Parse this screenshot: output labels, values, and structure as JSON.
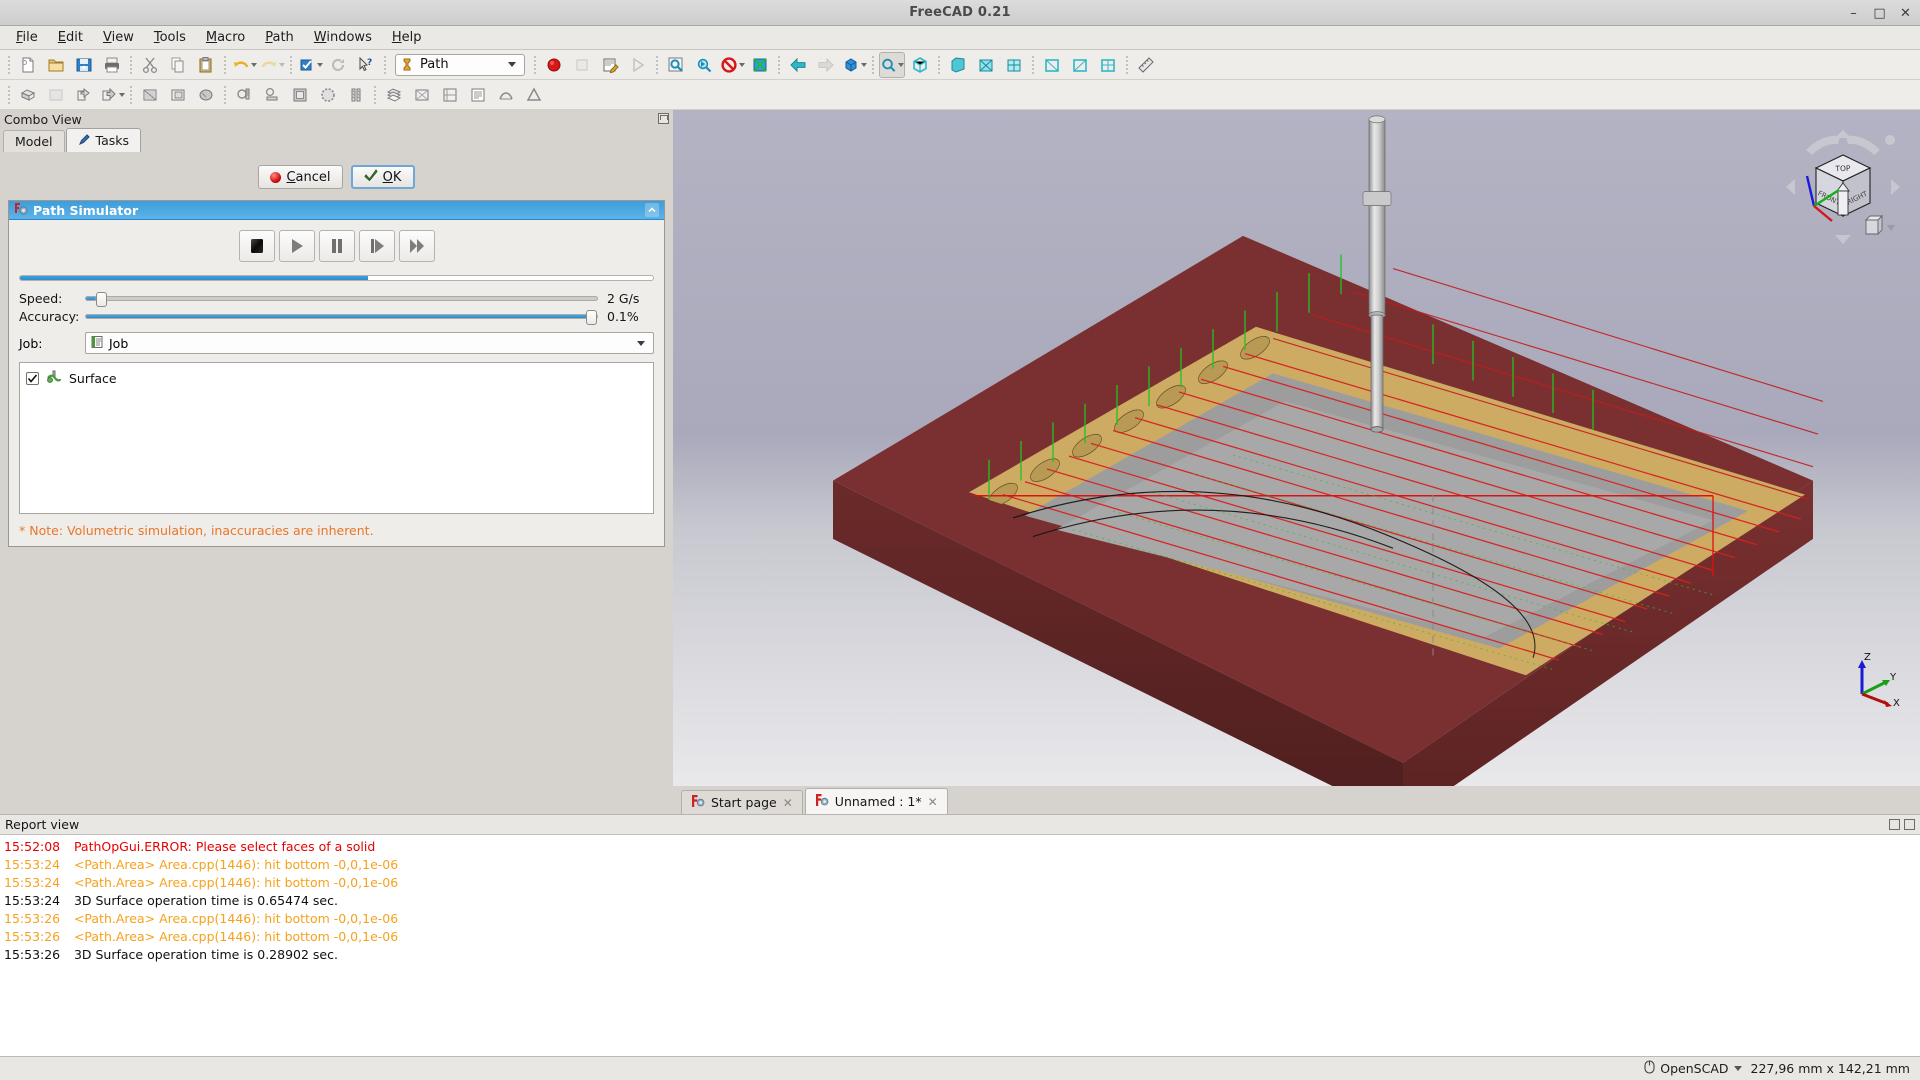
{
  "window": {
    "title": "FreeCAD 0.21",
    "controls": {
      "minimize": "–",
      "maximize": "□",
      "close": "✕"
    }
  },
  "menubar": {
    "items": [
      {
        "label": "File",
        "mnemonic": "F"
      },
      {
        "label": "Edit",
        "mnemonic": "E"
      },
      {
        "label": "View",
        "mnemonic": "V"
      },
      {
        "label": "Tools",
        "mnemonic": "T"
      },
      {
        "label": "Macro",
        "mnemonic": "M"
      },
      {
        "label": "Path",
        "mnemonic": "P"
      },
      {
        "label": "Windows",
        "mnemonic": "W"
      },
      {
        "label": "Help",
        "mnemonic": "H"
      }
    ]
  },
  "toolbar": {
    "workbench_label": "Path",
    "icons_row1": [
      "new-document-icon",
      "open-folder-icon",
      "save-icon",
      "print-icon",
      "cut-icon",
      "copy-icon",
      "paste-icon",
      "undo-icon",
      "redo-icon",
      "refresh-std-icon",
      "refresh-icon",
      "whats-this-icon"
    ],
    "icons_row2": [
      "path-job-icon",
      "path-post-process-icon",
      "path-export-template-icon",
      "path-inspect-icon",
      "path-profile-icon",
      "path-pocket-icon",
      "path-drilling-icon",
      "path-helix-icon",
      "path-adaptive-icon",
      "path-surface-icon",
      "path-waterline-icon",
      "path-engrave-icon",
      "path-deburr-icon",
      "path-vcarve-icon"
    ]
  },
  "combo_view": {
    "title": "Combo View",
    "tabs": [
      {
        "label": "Model",
        "icon": "model-icon",
        "active": false
      },
      {
        "label": "Tasks",
        "icon": "tasks-pencil-icon",
        "active": true
      }
    ]
  },
  "task_dialog": {
    "cancel_label": "Cancel",
    "ok_label": "OK",
    "cancel_mnemonic": "C",
    "ok_mnemonic": "O"
  },
  "path_simulator": {
    "title": "Path Simulator",
    "icon": "freecad-gear-icon",
    "collapse_icon": "chevron-up-icon",
    "transport": [
      {
        "name": "stop-button",
        "icon": "stop-square-icon"
      },
      {
        "name": "play-button",
        "icon": "play-triangle-icon"
      },
      {
        "name": "pause-button",
        "icon": "pause-bars-icon"
      },
      {
        "name": "step-button",
        "icon": "step-forward-icon"
      },
      {
        "name": "fast-forward-button",
        "icon": "fast-forward-icon"
      }
    ],
    "progress_percent": 55,
    "speed": {
      "label": "Speed:",
      "value": "2 G/s",
      "thumb_percent": 2
    },
    "accuracy": {
      "label": "Accuracy:",
      "value": "0.1%",
      "thumb_percent": 100
    },
    "job": {
      "label": "Job:",
      "value": "Job",
      "icon": "job-icon"
    },
    "operations": [
      {
        "label": "Surface",
        "checked": true,
        "icon": "surface-op-icon"
      }
    ],
    "note": "* Note: Volumetric simulation, inaccuracies are inherent."
  },
  "viewport": {
    "navigation_cube": {
      "faces": {
        "top": "TOP",
        "front": "FRONT",
        "right": "RIGHT"
      }
    },
    "axis_indicator": {
      "x": "X",
      "y": "Y",
      "z": "Z"
    },
    "colors": {
      "stock": "#6e2b2b",
      "machined_tan": "#d4b46a",
      "machined_gray": "#9a9a9a",
      "toolpath_cut": "#e02020",
      "toolpath_rapid": "#22c422",
      "tool": "#c9c9c9",
      "background_top": "#b3b3c4",
      "background_bottom": "#e9e9ec"
    }
  },
  "document_tabs": [
    {
      "label": "Start page",
      "icon": "freecad-icon",
      "active": false,
      "close": "✕"
    },
    {
      "label": "Unnamed : 1*",
      "icon": "freecad-icon",
      "active": true,
      "close": "✕"
    }
  ],
  "report_view": {
    "title": "Report view",
    "lines": [
      {
        "time": "15:52:08",
        "text": "PathOpGui.ERROR: Please select faces of a solid",
        "color": "#e60000"
      },
      {
        "time": "15:53:24",
        "text": "<Path.Area> Area.cpp(1446): hit bottom -0,0,1e-06",
        "color": "#f5a21e"
      },
      {
        "time": "15:53:24",
        "text": "<Path.Area> Area.cpp(1446): hit bottom -0,0,1e-06",
        "color": "#f5a21e"
      },
      {
        "time": "15:53:24",
        "text": "3D Surface operation time is 0.65474 sec.",
        "color": "#101010"
      },
      {
        "time": "15:53:26",
        "text": "<Path.Area> Area.cpp(1446): hit bottom -0,0,1e-06",
        "color": "#f5a21e"
      },
      {
        "time": "15:53:26",
        "text": "<Path.Area> Area.cpp(1446): hit bottom -0,0,1e-06",
        "color": "#f5a21e"
      },
      {
        "time": "15:53:26",
        "text": "3D Surface operation time is 0.28902 sec.",
        "color": "#101010"
      }
    ]
  },
  "status_bar": {
    "unit_system": "OpenSCAD",
    "dimensions": "227,96 mm x 142,21 mm",
    "mouse_icon": "mouse-icon"
  }
}
